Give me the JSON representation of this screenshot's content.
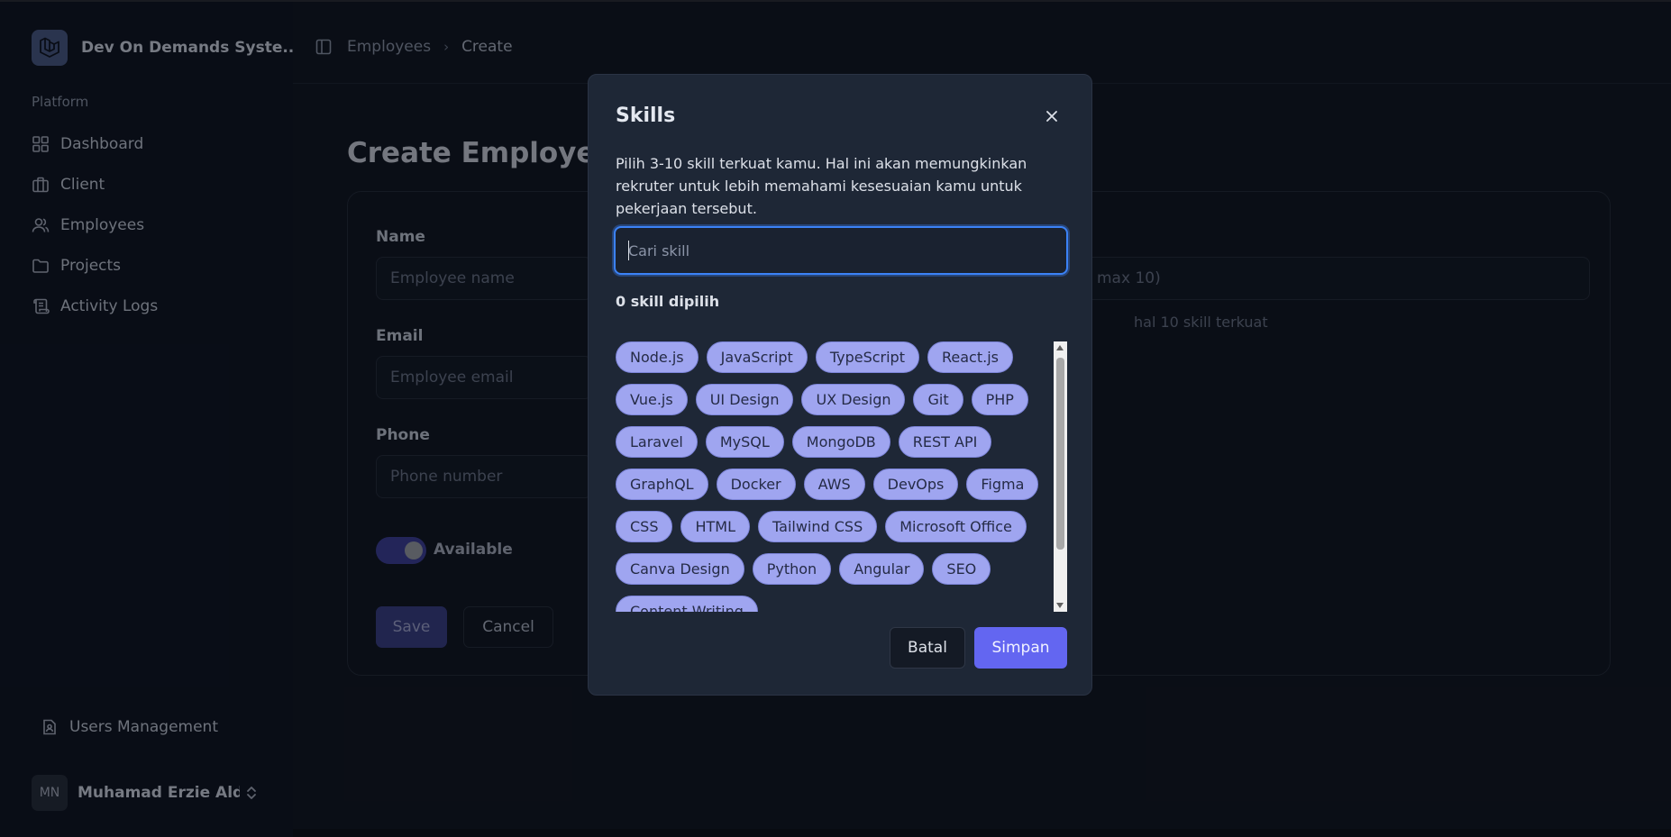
{
  "app": {
    "name": "Dev On Demands Syste..."
  },
  "sidebar": {
    "group_label": "Platform",
    "items": [
      {
        "label": "Dashboard"
      },
      {
        "label": "Client"
      },
      {
        "label": "Employees"
      },
      {
        "label": "Projects"
      },
      {
        "label": "Activity Logs"
      }
    ],
    "footer_item": "Users Management",
    "user": {
      "initials": "MN",
      "name": "Muhamad Erzie Aldr..."
    }
  },
  "breadcrumb": {
    "parent": "Employees",
    "current": "Create"
  },
  "page": {
    "title": "Create Employee",
    "name_label": "Name",
    "name_placeholder": "Employee name",
    "email_label": "Email",
    "email_placeholder": "Employee email",
    "phone_label": "Phone",
    "phone_placeholder": "Phone number",
    "skills_placeholder_partial": "max 10)",
    "skills_hint_partial": "hal 10 skill terkuat",
    "available_label": "Available",
    "save_label": "Save",
    "cancel_label": "Cancel"
  },
  "modal": {
    "title": "Skills",
    "description": "Pilih 3-10 skill terkuat kamu. Hal ini akan memungkinkan rekruter untuk lebih memahami kesesuaian kamu untuk pekerjaan tersebut.",
    "search_placeholder": "Cari skill",
    "search_value": "",
    "selected_count": "0 skill dipilih",
    "skills": [
      "Node.js",
      "JavaScript",
      "TypeScript",
      "React.js",
      "Vue.js",
      "UI Design",
      "UX Design",
      "Git",
      "PHP",
      "Laravel",
      "MySQL",
      "MongoDB",
      "REST API",
      "GraphQL",
      "Docker",
      "AWS",
      "DevOps",
      "Figma",
      "CSS",
      "HTML",
      "Tailwind CSS",
      "Microsoft Office",
      "Canva Design",
      "Python",
      "Angular",
      "SEO",
      "Content Writing"
    ],
    "cancel_label": "Batal",
    "submit_label": "Simpan"
  },
  "colors": {
    "accent": "#6366f1",
    "chip": "#9fa5f0",
    "focus_ring": "#3b82f6",
    "toggle_on": "#3d3f9a"
  }
}
